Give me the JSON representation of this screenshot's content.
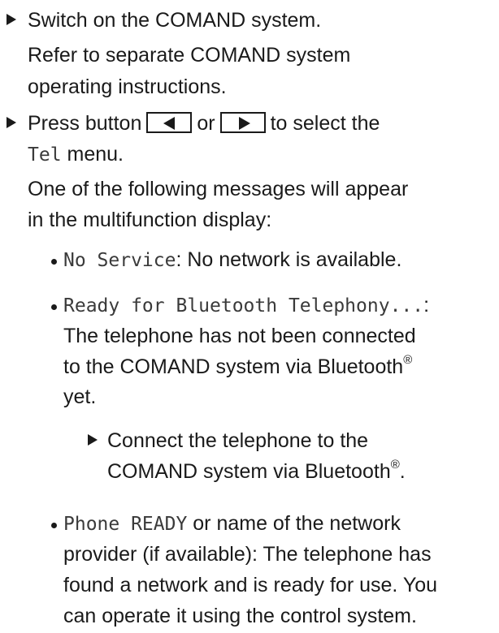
{
  "steps": [
    {
      "action": "Switch on the COMAND system.",
      "note_lines": [
        "Refer to separate COMAND system",
        "operating instructions."
      ]
    },
    {
      "action_part1": "Press button",
      "button_left_label": "left",
      "or_text": "or",
      "button_right_label": "right",
      "action_part2": "to select the",
      "menu_code": "Tel",
      "menu_suffix": " menu.",
      "result_lines": [
        "One of the following messages will appear",
        "in the multifunction display:"
      ]
    }
  ],
  "messages": [
    {
      "code": "No Service",
      "text": ": No network is available."
    },
    {
      "code": "Ready for Bluetooth Telephony...",
      "text_after_code": ":",
      "lines": [
        "The telephone has not been connected",
        "to the COMAND system via Bluetooth"
      ],
      "reg_mark": "®",
      "last_line": "yet.",
      "substep_lines": [
        "Connect the telephone to the",
        "COMAND system via Bluetooth"
      ],
      "substep_reg": "®",
      "substep_end": "."
    },
    {
      "code": "Phone READY",
      "text": " or name of the network",
      "lines": [
        "provider (if available): The telephone has",
        "found a network and is ready for use. You",
        "can operate it using the control system."
      ]
    }
  ],
  "icons": {
    "step_marker": "triangle-right-icon",
    "list_marker": "bullet-icon",
    "button_left": "triangle-left-icon",
    "button_right": "triangle-right-icon"
  }
}
